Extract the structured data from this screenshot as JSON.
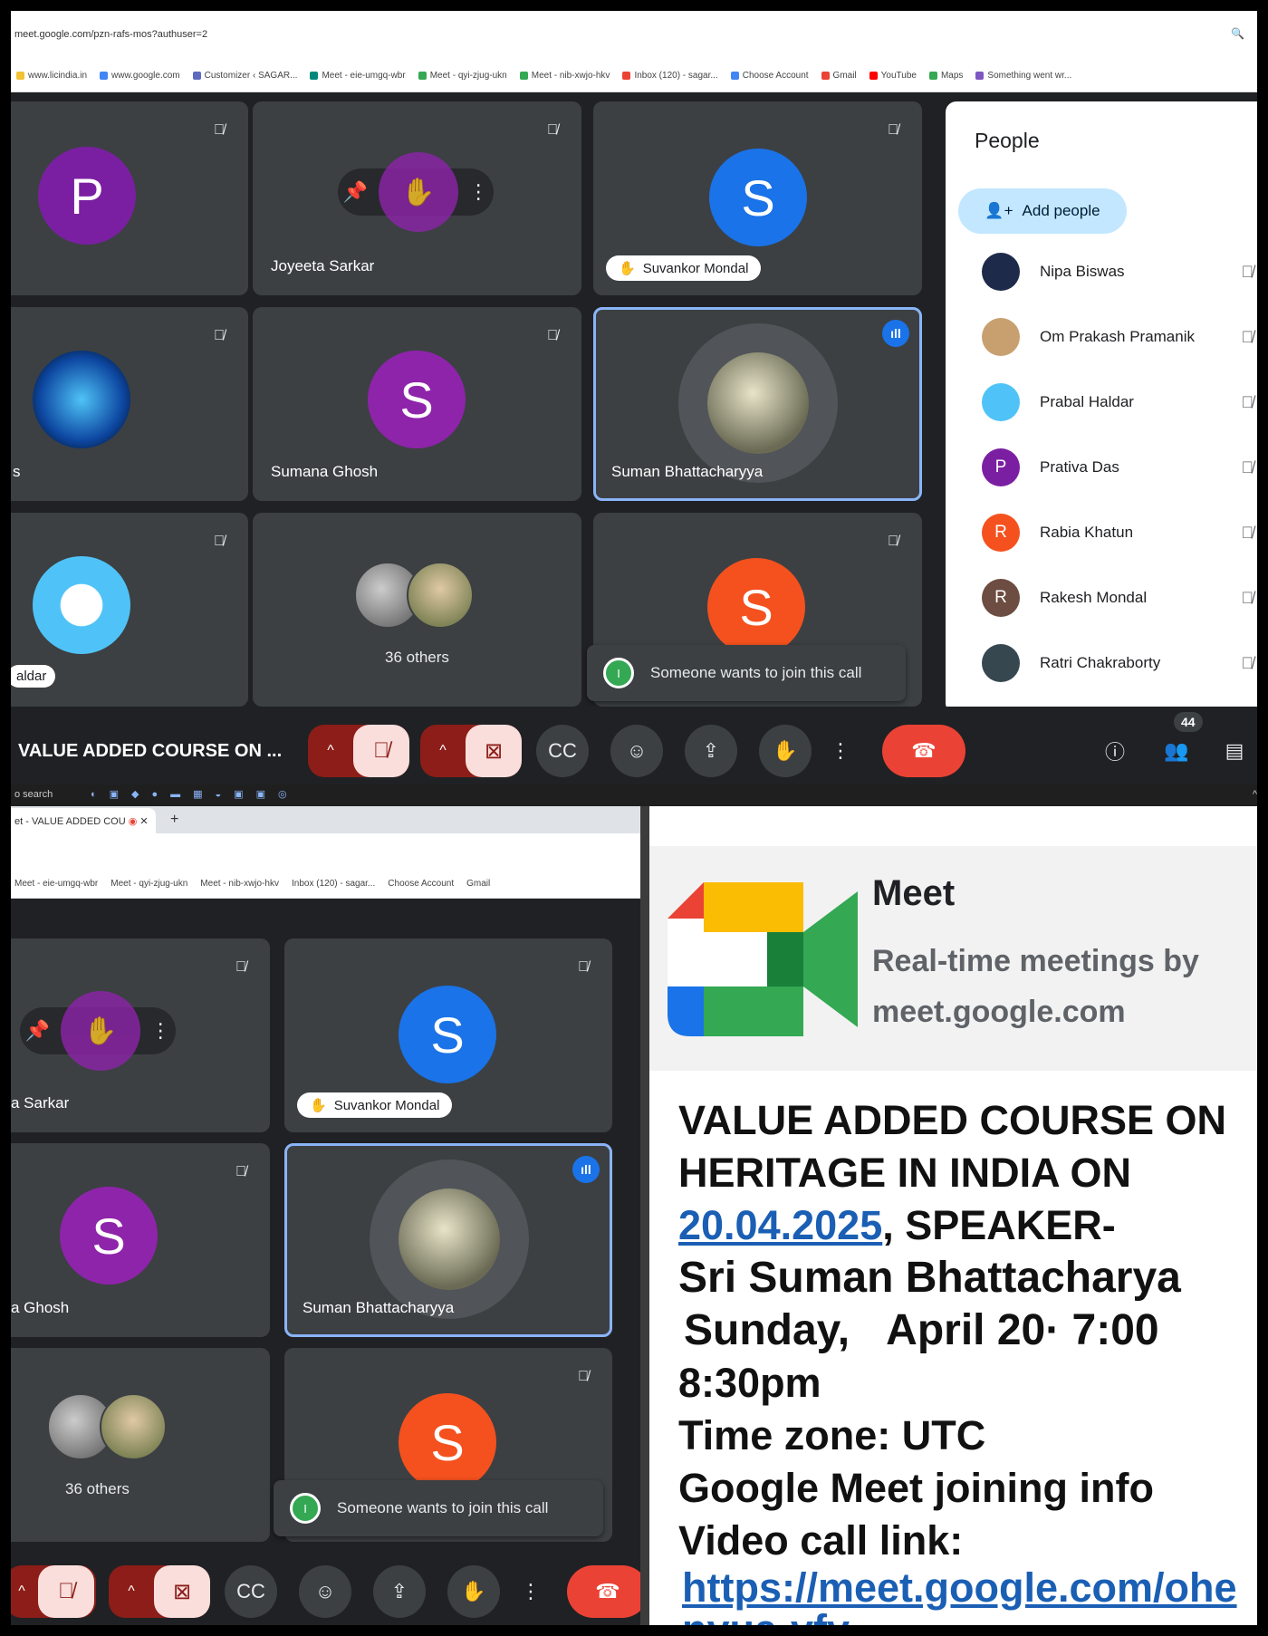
{
  "browser": {
    "url": "meet.google.com/pzn-rafs-mos?authuser=2",
    "zoom_icon": "zoom-icon",
    "bookmarks": [
      "www.licindia.in",
      "www.google.com",
      "Customizer ‹ SAGAR...",
      "Meet - eie-umgq-wbr",
      "Meet - qyi-zjug-ukn",
      "Meet - nib-xwjo-hkv",
      "Inbox (120) - sagar...",
      "Choose Account",
      "Gmail",
      "YouTube",
      "Maps",
      "Something went wr..."
    ]
  },
  "tiles": {
    "p_initial": "P",
    "joyeeta": "Joyeeta Sarkar",
    "suvankor_initial": "S",
    "suvankor": "Suvankor Mondal",
    "sumana_initial": "S",
    "sumana": "Sumana Ghosh",
    "suman": "Suman Bhattacharyya",
    "others": "36 others",
    "orange_initial": "S",
    "aldar": "aldar",
    "cut_s": "s"
  },
  "toast": {
    "text": "Someone wants to join this call",
    "icon": "I"
  },
  "controls": {
    "meeting_title": "VALUE ADDED COURSE ON ...",
    "people_count": "44"
  },
  "people_panel": {
    "title": "People",
    "add_label": "Add people",
    "members": [
      {
        "name": "Nipa Biswas",
        "initial": "",
        "color": "#1e2a4a"
      },
      {
        "name": "Om Prakash Pramanik",
        "initial": "",
        "color": "#c8a070"
      },
      {
        "name": "Prabal Haldar",
        "initial": "",
        "color": "#4fc3f7"
      },
      {
        "name": "Prativa Das",
        "initial": "P",
        "color": "#7b1fa2"
      },
      {
        "name": "Rabia Khatun",
        "initial": "R",
        "color": "#f4511e"
      },
      {
        "name": "Rakesh Mondal",
        "initial": "R",
        "color": "#6d4c41"
      },
      {
        "name": "Ratri Chakraborty",
        "initial": "",
        "color": "#37474f"
      }
    ]
  },
  "taskbar": {
    "search": "o search"
  },
  "bottom_left": {
    "tab": "et - VALUE ADDED COU",
    "bookmarks": [
      "Meet - eie-umgq-wbr",
      "Meet - qyi-zjug-ukn",
      "Meet - nib-xwjo-hkv",
      "Inbox (120) - sagar...",
      "Choose Account",
      "Gmail"
    ],
    "sarkar": "a Sarkar",
    "suvankor": "Suvankor Mondal",
    "suvankor_initial": "S",
    "ghosh": "a Ghosh",
    "sumana_initial": "S",
    "suman": "Suman Bhattacharyya",
    "others": "36 others",
    "orange_initial": "S"
  },
  "invite": {
    "app_name": "Meet",
    "tagline": "Real-time meetings by",
    "domain": "meet.google.com",
    "line1": "VALUE ADDED COURSE ON",
    "line2": "HERITAGE IN INDIA ON",
    "date_link": "20.04.2025",
    "line3_rest": ", SPEAKER-",
    "line4": "Sri Suman Bhattacharya",
    "day": "Sunday,",
    "month_day": "April  20",
    "time_start": "· 7:00",
    "time_end": "8:30pm",
    "timezone": "Time zone: UTC",
    "join_info": "Google Meet joining info",
    "video_label": "Video call link:",
    "link1": "https://meet.google.com/ohe",
    "link2": "nyua-vfv"
  },
  "colors": {
    "meet_dark": "#202124",
    "tile": "#3c4043",
    "purple": "#8e24aa",
    "blue": "#1a73e8",
    "orange": "#f4511e",
    "end_red": "#ea4335",
    "link": "#1a5fb4"
  }
}
